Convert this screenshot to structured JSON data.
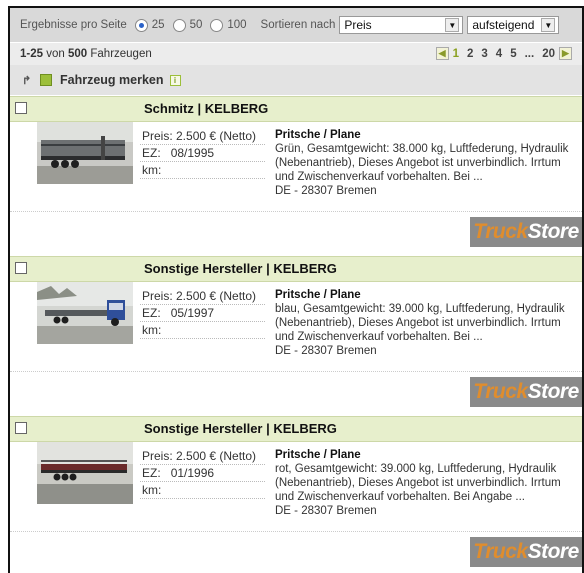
{
  "toolbar": {
    "results_per_page_label": "Ergebnisse pro Seite",
    "options": [
      "25",
      "50",
      "100"
    ],
    "selected": "25",
    "sort_label": "Sortieren nach",
    "sort_value": "Preis",
    "order_value": "aufsteigend"
  },
  "summary": {
    "range": "1-25",
    "of_text": "von",
    "total": "500",
    "unit": "Fahrzeugen"
  },
  "pager": {
    "pages": [
      "1",
      "2",
      "3",
      "4",
      "5",
      "...",
      "20"
    ],
    "current": "1"
  },
  "merken": {
    "label": "Fahrzeug merken"
  },
  "listings": [
    {
      "title": "Schmitz | KELBERG",
      "price": "Preis: 2.500 € (Netto)",
      "ez_label": "EZ:",
      "ez": "08/1995",
      "km_label": "km:",
      "type": "Pritsche / Plane",
      "description": "Grün, Gesamtgewicht: 38.000 kg, Luftfederung, Hydraulik (Nebenantrieb), Dieses Angebot ist unverbindlich. Irrtum und Zwischenverkauf vorbehalten. Bei ...",
      "location": "DE - 28307 Bremen",
      "logo_a": "Truck",
      "logo_b": "Store"
    },
    {
      "title": "Sonstige Hersteller | KELBERG",
      "price": "Preis: 2.500 € (Netto)",
      "ez_label": "EZ:",
      "ez": "05/1997",
      "km_label": "km:",
      "type": "Pritsche / Plane",
      "description": "blau, Gesamtgewicht: 39.000 kg, Luftfederung, Hydraulik (Nebenantrieb), Dieses Angebot ist unverbindlich. Irrtum und Zwischenverkauf vorbehalten. Bei ...",
      "location": "DE - 28307 Bremen",
      "logo_a": "Truck",
      "logo_b": "Store"
    },
    {
      "title": "Sonstige Hersteller | KELBERG",
      "price": "Preis: 2.500 € (Netto)",
      "ez_label": "EZ:",
      "ez": "01/1996",
      "km_label": "km:",
      "type": "Pritsche / Plane",
      "description": "rot, Gesamtgewicht: 39.000 kg, Luftfederung, Hydraulik (Nebenantrieb), Dieses Angebot ist unverbindlich. Irrtum und Zwischenverkauf vorbehalten. Bei Angabe ...",
      "location": "DE - 28307 Bremen",
      "logo_a": "Truck",
      "logo_b": "Store"
    }
  ],
  "colors": {
    "accent": "#8aa020",
    "header_bg": "#e7efcc",
    "logo_orange": "#e08d2d"
  }
}
